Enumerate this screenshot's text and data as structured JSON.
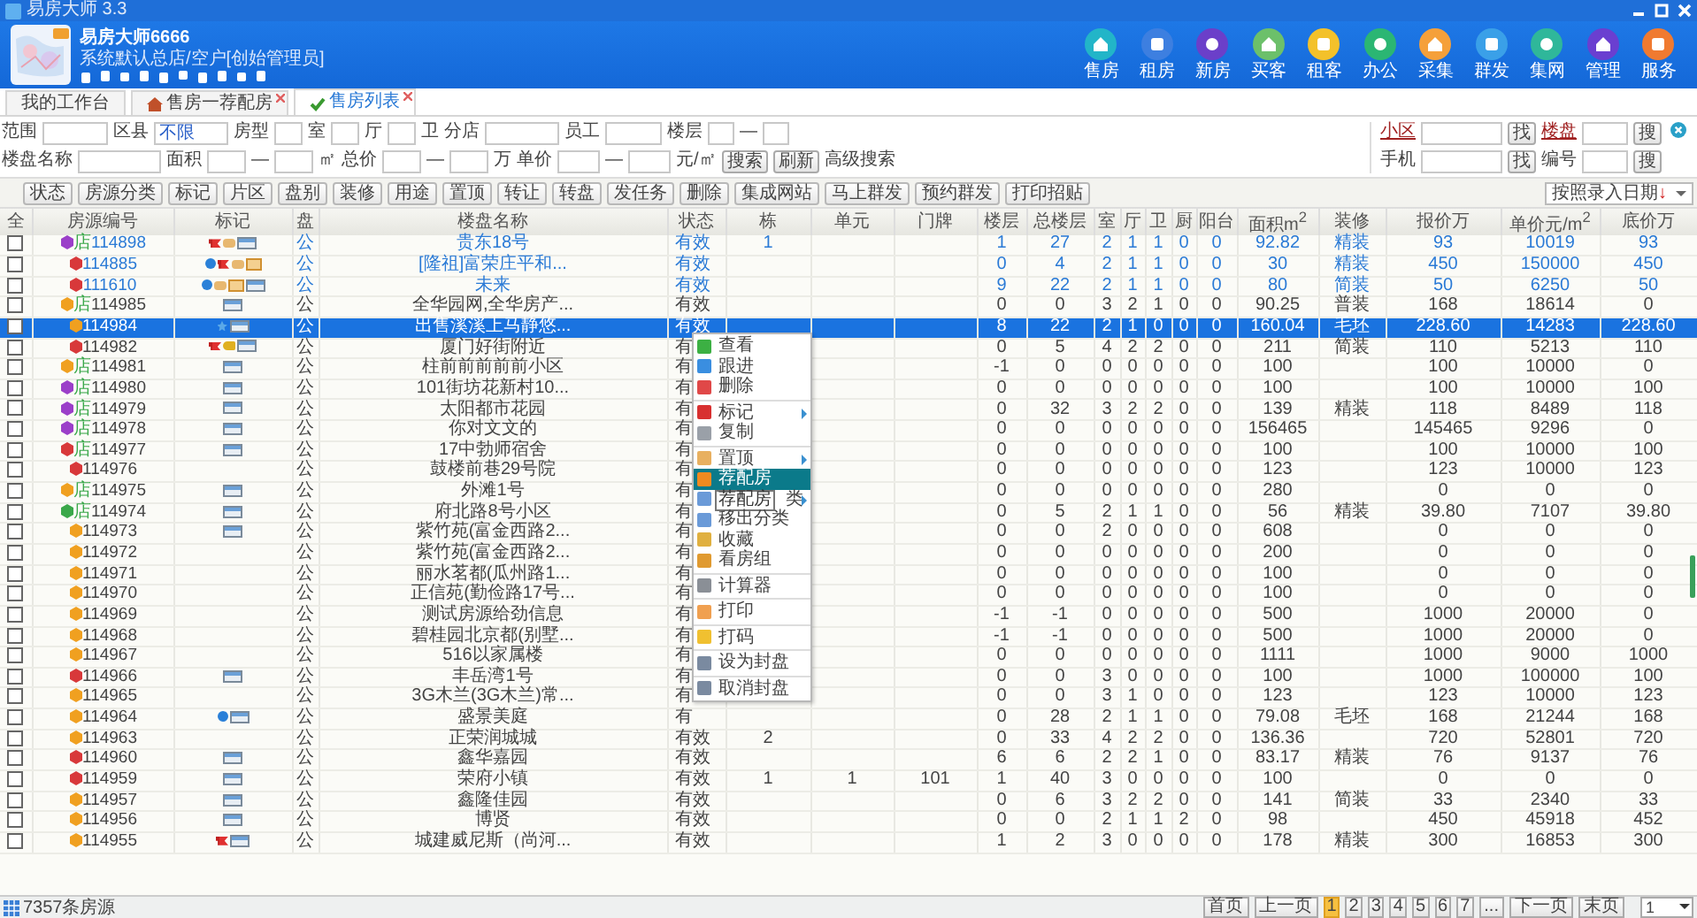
{
  "window": {
    "title": "易房大师 3.3"
  },
  "user": {
    "name": "易房大师6666",
    "role": "系统默认总店/空户[创始管理员]"
  },
  "nav": [
    {
      "label": "售房",
      "color": "#22b5c8"
    },
    {
      "label": "租房",
      "color": "#3d7fe0"
    },
    {
      "label": "新房",
      "color": "#6b3fc9"
    },
    {
      "label": "买客",
      "color": "#6cc06a"
    },
    {
      "label": "租客",
      "color": "#f3c12a"
    },
    {
      "label": "办公",
      "color": "#2bb673"
    },
    {
      "label": "采集",
      "color": "#f5a03a"
    },
    {
      "label": "群发",
      "color": "#3aa0e8"
    },
    {
      "label": "集网",
      "color": "#2fb79a"
    },
    {
      "label": "管理",
      "color": "#6a3fd0"
    },
    {
      "label": "服务",
      "color": "#f07a30"
    }
  ],
  "tabs": [
    {
      "label": "我的工作台",
      "selected": false,
      "closable": false
    },
    {
      "label": "售房一荐配房",
      "selected": false,
      "closable": true
    },
    {
      "label": "售房列表",
      "selected": true,
      "closable": true
    }
  ],
  "filters": [
    [
      {
        "kind": "label",
        "text": "范围"
      },
      {
        "kind": "input"
      },
      {
        "kind": "label",
        "text": "区县"
      },
      {
        "kind": "input",
        "value": "不限"
      },
      {
        "kind": "label",
        "text": "房型"
      },
      {
        "kind": "input"
      },
      {
        "kind": "label",
        "text": "室"
      },
      {
        "kind": "input"
      },
      {
        "kind": "label",
        "text": "厅"
      },
      {
        "kind": "input"
      },
      {
        "kind": "label",
        "text": "卫"
      },
      {
        "kind": "label",
        "text": "分店"
      },
      {
        "kind": "input"
      },
      {
        "kind": "label",
        "text": "员工"
      },
      {
        "kind": "input"
      },
      {
        "kind": "label",
        "text": "楼层"
      },
      {
        "kind": "input"
      },
      {
        "kind": "label",
        "text": "—"
      },
      {
        "kind": "input"
      }
    ],
    [
      {
        "kind": "label",
        "text": "楼盘名称"
      },
      {
        "kind": "input"
      },
      {
        "kind": "label",
        "text": "面积"
      },
      {
        "kind": "input"
      },
      {
        "kind": "label",
        "text": "—"
      },
      {
        "kind": "input"
      },
      {
        "kind": "label",
        "text": "㎡"
      },
      {
        "kind": "label",
        "text": "总价"
      },
      {
        "kind": "input"
      },
      {
        "kind": "label",
        "text": "—"
      },
      {
        "kind": "input"
      },
      {
        "kind": "label",
        "text": "万"
      },
      {
        "kind": "label",
        "text": "单价"
      },
      {
        "kind": "input"
      },
      {
        "kind": "label",
        "text": "—"
      },
      {
        "kind": "input"
      },
      {
        "kind": "label",
        "text": "元/㎡"
      },
      {
        "kind": "button",
        "text": "搜索"
      },
      {
        "kind": "button",
        "text": "刷新"
      },
      {
        "kind": "label",
        "text": "高级搜索"
      }
    ]
  ],
  "quick_search": [
    [
      {
        "kind": "link",
        "text": "小区"
      },
      {
        "kind": "input"
      },
      {
        "kind": "button",
        "text": "找"
      },
      {
        "kind": "link",
        "text": "楼盘"
      },
      {
        "kind": "input"
      },
      {
        "kind": "button",
        "text": "搜"
      }
    ],
    [
      {
        "kind": "label",
        "text": "手机"
      },
      {
        "kind": "input"
      },
      {
        "kind": "button",
        "text": "找"
      },
      {
        "kind": "label",
        "text": "编号"
      },
      {
        "kind": "input"
      },
      {
        "kind": "button",
        "text": "搜"
      }
    ]
  ],
  "toolbar": [
    "状态",
    "房源分类",
    "标记",
    "片区",
    "盘别",
    "装修",
    "用途",
    "置顶",
    "转让",
    "转盘",
    "发任务",
    "删除",
    "集成网站",
    "马上群发",
    "预约群发",
    "打印招贴"
  ],
  "sort": {
    "label": "按照录入日期",
    "arrow": "↓"
  },
  "table": {
    "columns": [
      "全",
      "房源编号",
      "标记",
      "盘",
      "楼盘名称",
      "状态",
      "栋",
      "单元",
      "门牌",
      "楼层",
      "总楼层",
      "室",
      "厅",
      "卫",
      "厨",
      "阳台",
      "面积m$^{2}$",
      "装修",
      "报价万",
      "单价元/m$^{2}$",
      "底价万"
    ],
    "rows": [
      {
        "checked": false,
        "selected": false,
        "highlight": true,
        "color": "#9b3fc9",
        "tag": "店",
        "id": "114898",
        "marks": [
          {
            "kind": "flag"
          },
          {
            "kind": "thumb"
          },
          {
            "kind": "card"
          }
        ],
        "pan": "公",
        "name": "贵东18号",
        "status": "有效",
        "building": "1",
        "floor": "1",
        "floors": "27",
        "rooms": "2",
        "halls": "1",
        "baths": "1",
        "kitchens": "0",
        "balconies": "0",
        "area": "92.82",
        "decoration": "精装",
        "price": "93",
        "unit_price": "10019",
        "base_price": "93"
      },
      {
        "checked": false,
        "selected": false,
        "highlight": true,
        "color": "#d8383a",
        "id": "114885",
        "marks": [
          {
            "kind": "paw"
          },
          {
            "kind": "flag"
          },
          {
            "kind": "thumb"
          },
          {
            "kind": "note"
          }
        ],
        "pan": "公",
        "name": "[隆祖]富荣庄平和...",
        "status": "有效",
        "floor": "0",
        "floors": "4",
        "rooms": "2",
        "halls": "1",
        "baths": "1",
        "kitchens": "0",
        "balconies": "0",
        "area": "30",
        "decoration": "精装",
        "price": "450",
        "unit_price": "150000",
        "base_price": "450"
      },
      {
        "checked": false,
        "selected": false,
        "highlight": true,
        "color": "#d8383a",
        "id": "111610",
        "marks": [
          {
            "kind": "paw"
          },
          {
            "kind": "thumb"
          },
          {
            "kind": "note"
          },
          {
            "kind": "card"
          }
        ],
        "pan": "公",
        "name": "未来",
        "status": "有效",
        "floor": "9",
        "floors": "22",
        "rooms": "2",
        "halls": "1",
        "baths": "1",
        "kitchens": "0",
        "balconies": "0",
        "area": "80",
        "decoration": "简装",
        "price": "50",
        "unit_price": "6250",
        "base_price": "50"
      },
      {
        "checked": false,
        "selected": false,
        "highlight": false,
        "color": "#f0a020",
        "tag": "店",
        "id": "114985",
        "marks": [
          {
            "kind": "card"
          }
        ],
        "pan": "公",
        "name": "全华园网,全华房产...",
        "status": "有效",
        "floor": "0",
        "floors": "0",
        "rooms": "3",
        "halls": "2",
        "baths": "1",
        "kitchens": "0",
        "balconies": "0",
        "area": "90.25",
        "decoration": "普装",
        "price": "168",
        "unit_price": "18614",
        "base_price": "0"
      },
      {
        "checked": false,
        "selected": true,
        "highlight": false,
        "color": "#f0a020",
        "id": "114984",
        "marks": [
          {
            "kind": "star"
          },
          {
            "kind": "card"
          }
        ],
        "pan": "公",
        "name": "出售溪溪上马静悠...",
        "status": "有效",
        "floor": "8",
        "floors": "22",
        "rooms": "2",
        "halls": "1",
        "baths": "0",
        "kitchens": "0",
        "balconies": "0",
        "area": "160.04",
        "decoration": "毛坯",
        "price": "228.60",
        "unit_price": "14283",
        "base_price": "228.60"
      },
      {
        "checked": false,
        "selected": false,
        "highlight": false,
        "color": "#d8383a",
        "id": "114982",
        "marks": [
          {
            "kind": "flag"
          },
          {
            "kind": "key"
          },
          {
            "kind": "card"
          }
        ],
        "pan": "公",
        "name": "厦门好街附近",
        "status": "有",
        "floor": "0",
        "floors": "5",
        "rooms": "4",
        "halls": "2",
        "baths": "2",
        "kitchens": "0",
        "balconies": "0",
        "area": "211",
        "decoration": "简装",
        "price": "110",
        "unit_price": "5213",
        "base_price": "110"
      },
      {
        "checked": false,
        "selected": false,
        "highlight": false,
        "color": "#f0a020",
        "tag": "店",
        "id": "114981",
        "marks": [
          {
            "kind": "card"
          }
        ],
        "pan": "公",
        "name": "柱前前前前前小区",
        "status": "有",
        "floor": "-1",
        "floors": "0",
        "rooms": "0",
        "halls": "0",
        "baths": "0",
        "kitchens": "0",
        "balconies": "0",
        "area": "100",
        "price": "100",
        "unit_price": "10000",
        "base_price": "0"
      },
      {
        "checked": false,
        "selected": false,
        "highlight": false,
        "color": "#9b3fc9",
        "tag": "店",
        "id": "114980",
        "marks": [
          {
            "kind": "card"
          }
        ],
        "pan": "公",
        "name": "101街坊花新村10...",
        "status": "有",
        "floor": "0",
        "floors": "0",
        "rooms": "0",
        "halls": "0",
        "baths": "0",
        "kitchens": "0",
        "balconies": "0",
        "area": "100",
        "price": "100",
        "unit_price": "10000",
        "base_price": "100"
      },
      {
        "checked": false,
        "selected": false,
        "highlight": false,
        "color": "#9b3fc9",
        "tag": "店",
        "id": "114979",
        "marks": [
          {
            "kind": "card"
          }
        ],
        "pan": "公",
        "name": "太阳都市花园",
        "status": "有",
        "floor": "0",
        "floors": "32",
        "rooms": "3",
        "halls": "2",
        "baths": "2",
        "kitchens": "0",
        "balconies": "0",
        "area": "139",
        "decoration": "精装",
        "price": "118",
        "unit_price": "8489",
        "base_price": "118"
      },
      {
        "checked": false,
        "selected": false,
        "highlight": false,
        "color": "#9b3fc9",
        "tag": "店",
        "id": "114978",
        "marks": [
          {
            "kind": "card"
          }
        ],
        "pan": "公",
        "name": "你对文文的",
        "status": "有",
        "floor": "0",
        "floors": "0",
        "rooms": "0",
        "halls": "0",
        "baths": "0",
        "kitchens": "0",
        "balconies": "0",
        "area": "156465",
        "price": "145465",
        "unit_price": "9296",
        "base_price": "0"
      },
      {
        "checked": false,
        "selected": false,
        "highlight": false,
        "color": "#d8383a",
        "tag": "店",
        "id": "114977",
        "marks": [
          {
            "kind": "card"
          }
        ],
        "pan": "公",
        "name": "17中勃师宿舍",
        "status": "有",
        "floor": "0",
        "floors": "0",
        "rooms": "0",
        "halls": "0",
        "baths": "0",
        "kitchens": "0",
        "balconies": "0",
        "area": "100",
        "price": "100",
        "unit_price": "10000",
        "base_price": "100"
      },
      {
        "checked": false,
        "selected": false,
        "highlight": false,
        "color": "#d8383a",
        "id": "114976",
        "pan": "公",
        "name": "鼓楼前巷29号院",
        "status": "有",
        "floor": "0",
        "floors": "0",
        "rooms": "0",
        "halls": "0",
        "baths": "0",
        "kitchens": "0",
        "balconies": "0",
        "area": "123",
        "price": "123",
        "unit_price": "10000",
        "base_price": "123"
      },
      {
        "checked": false,
        "selected": false,
        "highlight": false,
        "color": "#f0a020",
        "tag": "店",
        "id": "114975",
        "marks": [
          {
            "kind": "card"
          }
        ],
        "pan": "公",
        "name": "外滩1号",
        "status": "有",
        "floor": "0",
        "floors": "0",
        "rooms": "0",
        "halls": "0",
        "baths": "0",
        "kitchens": "0",
        "balconies": "0",
        "area": "280",
        "price": "0",
        "unit_price": "0",
        "base_price": "0"
      },
      {
        "checked": false,
        "selected": false,
        "highlight": false,
        "color": "#3aa84a",
        "tag": "店",
        "id": "114974",
        "marks": [
          {
            "kind": "card"
          }
        ],
        "pan": "公",
        "name": "府北路8号小区",
        "status": "有",
        "floor": "0",
        "floors": "5",
        "rooms": "2",
        "halls": "1",
        "baths": "1",
        "kitchens": "0",
        "balconies": "0",
        "area": "56",
        "decoration": "精装",
        "price": "39.80",
        "unit_price": "7107",
        "base_price": "39.80"
      },
      {
        "checked": false,
        "selected": false,
        "highlight": false,
        "color": "#f0a020",
        "id": "114973",
        "marks": [
          {
            "kind": "card"
          }
        ],
        "pan": "公",
        "name": "紫竹苑(富金西路2...",
        "status": "有",
        "floor": "0",
        "floors": "0",
        "rooms": "2",
        "halls": "0",
        "baths": "0",
        "kitchens": "0",
        "balconies": "0",
        "area": "608",
        "price": "0",
        "unit_price": "0",
        "base_price": "0"
      },
      {
        "checked": false,
        "selected": false,
        "highlight": false,
        "color": "#f0a020",
        "id": "114972",
        "pan": "公",
        "name": "紫竹苑(富金西路2...",
        "status": "有",
        "floor": "0",
        "floors": "0",
        "rooms": "0",
        "halls": "0",
        "baths": "0",
        "kitchens": "0",
        "balconies": "0",
        "area": "200",
        "price": "0",
        "unit_price": "0",
        "base_price": "0"
      },
      {
        "checked": false,
        "selected": false,
        "highlight": false,
        "color": "#f0a020",
        "id": "114971",
        "pan": "公",
        "name": "丽水茗都(瓜州路1...",
        "status": "有",
        "floor": "0",
        "floors": "0",
        "rooms": "0",
        "halls": "0",
        "baths": "0",
        "kitchens": "0",
        "balconies": "0",
        "area": "100",
        "price": "0",
        "unit_price": "0",
        "base_price": "0"
      },
      {
        "checked": false,
        "selected": false,
        "highlight": false,
        "color": "#f0a020",
        "id": "114970",
        "pan": "公",
        "name": "正信苑(勤俭路17号...",
        "status": "有",
        "floor": "0",
        "floors": "0",
        "rooms": "0",
        "halls": "0",
        "baths": "0",
        "kitchens": "0",
        "balconies": "0",
        "area": "100",
        "price": "0",
        "unit_price": "0",
        "base_price": "0"
      },
      {
        "checked": false,
        "selected": false,
        "highlight": false,
        "color": "#f0a020",
        "id": "114969",
        "pan": "公",
        "name": "测试房源给劲信息",
        "status": "有",
        "floor": "-1",
        "floors": "-1",
        "rooms": "0",
        "halls": "0",
        "baths": "0",
        "kitchens": "0",
        "balconies": "0",
        "area": "500",
        "price": "1000",
        "unit_price": "20000",
        "base_price": "0"
      },
      {
        "checked": false,
        "selected": false,
        "highlight": false,
        "color": "#f0a020",
        "id": "114968",
        "pan": "公",
        "name": "碧桂园北京都(别墅...",
        "status": "有",
        "floor": "-1",
        "floors": "-1",
        "rooms": "0",
        "halls": "0",
        "baths": "0",
        "kitchens": "0",
        "balconies": "0",
        "area": "500",
        "price": "1000",
        "unit_price": "20000",
        "base_price": "0"
      },
      {
        "checked": false,
        "selected": false,
        "highlight": false,
        "color": "#f0a020",
        "id": "114967",
        "pan": "公",
        "name": "516以家属楼",
        "status": "有",
        "floor": "0",
        "floors": "0",
        "rooms": "0",
        "halls": "0",
        "baths": "0",
        "kitchens": "0",
        "balconies": "0",
        "area": "1111",
        "price": "1000",
        "unit_price": "9000",
        "base_price": "1000"
      },
      {
        "checked": false,
        "selected": false,
        "highlight": false,
        "color": "#d8383a",
        "id": "114966",
        "marks": [
          {
            "kind": "card"
          }
        ],
        "pan": "公",
        "name": "丰岳湾1号",
        "status": "有",
        "floor": "0",
        "floors": "0",
        "rooms": "3",
        "halls": "0",
        "baths": "0",
        "kitchens": "0",
        "balconies": "0",
        "area": "100",
        "price": "1000",
        "unit_price": "100000",
        "base_price": "100"
      },
      {
        "checked": false,
        "selected": false,
        "highlight": false,
        "color": "#f0a020",
        "id": "114965",
        "pan": "公",
        "name": "3G木兰(3G木兰)常...",
        "status": "有",
        "floor": "0",
        "floors": "0",
        "rooms": "3",
        "halls": "1",
        "baths": "0",
        "kitchens": "0",
        "balconies": "0",
        "area": "123",
        "price": "123",
        "unit_price": "10000",
        "base_price": "123"
      },
      {
        "checked": false,
        "selected": false,
        "highlight": false,
        "color": "#f0a020",
        "id": "114964",
        "marks": [
          {
            "kind": "paw"
          },
          {
            "kind": "card"
          }
        ],
        "pan": "公",
        "name": "盛景美庭",
        "status": "有",
        "floor": "0",
        "floors": "28",
        "rooms": "2",
        "halls": "1",
        "baths": "1",
        "kitchens": "0",
        "balconies": "0",
        "area": "79.08",
        "decoration": "毛坯",
        "price": "168",
        "unit_price": "21244",
        "base_price": "168"
      },
      {
        "checked": false,
        "selected": false,
        "highlight": false,
        "color": "#f0a020",
        "id": "114963",
        "pan": "公",
        "name": "正荣润城城",
        "status": "有效",
        "building": "2",
        "floor": "0",
        "floors": "33",
        "rooms": "4",
        "halls": "2",
        "baths": "2",
        "kitchens": "0",
        "balconies": "0",
        "area": "136.36",
        "price": "720",
        "unit_price": "52801",
        "base_price": "720"
      },
      {
        "checked": false,
        "selected": false,
        "highlight": false,
        "color": "#d8383a",
        "id": "114960",
        "marks": [
          {
            "kind": "card"
          }
        ],
        "pan": "公",
        "name": "鑫华嘉园",
        "status": "有效",
        "floor": "6",
        "floors": "6",
        "rooms": "2",
        "halls": "2",
        "baths": "1",
        "kitchens": "0",
        "balconies": "0",
        "area": "83.17",
        "decoration": "精装",
        "price": "76",
        "unit_price": "9137",
        "base_price": "76"
      },
      {
        "checked": false,
        "selected": false,
        "highlight": false,
        "color": "#d8383a",
        "id": "114959",
        "marks": [
          {
            "kind": "card"
          }
        ],
        "pan": "公",
        "name": "荣府小镇",
        "status": "有效",
        "building": "1",
        "unit": "1",
        "door": "101",
        "floor": "1",
        "floors": "40",
        "rooms": "3",
        "halls": "0",
        "baths": "0",
        "kitchens": "0",
        "balconies": "0",
        "area": "100",
        "price": "0",
        "unit_price": "0",
        "base_price": "0"
      },
      {
        "checked": false,
        "selected": false,
        "highlight": false,
        "color": "#f0a020",
        "id": "114957",
        "marks": [
          {
            "kind": "card"
          }
        ],
        "pan": "公",
        "name": "鑫隆佳园",
        "status": "有效",
        "floor": "0",
        "floors": "6",
        "rooms": "3",
        "halls": "2",
        "baths": "2",
        "kitchens": "0",
        "balconies": "0",
        "area": "141",
        "decoration": "简装",
        "price": "33",
        "unit_price": "2340",
        "base_price": "33"
      },
      {
        "checked": false,
        "selected": false,
        "highlight": false,
        "color": "#f0a020",
        "id": "114956",
        "marks": [
          {
            "kind": "card"
          }
        ],
        "pan": "公",
        "name": "博贤",
        "status": "有效",
        "floor": "0",
        "floors": "0",
        "rooms": "2",
        "halls": "1",
        "baths": "1",
        "kitchens": "2",
        "balconies": "0",
        "area": "98",
        "price": "450",
        "unit_price": "45918",
        "base_price": "452"
      },
      {
        "checked": false,
        "selected": false,
        "highlight": false,
        "color": "#f0a020",
        "id": "114955",
        "marks": [
          {
            "kind": "flag"
          },
          {
            "kind": "card"
          }
        ],
        "pan": "公",
        "name": "城建威尼斯（尚河...",
        "status": "有效",
        "floor": "1",
        "floors": "2",
        "rooms": "3",
        "halls": "0",
        "baths": "0",
        "kitchens": "0",
        "balconies": "0",
        "area": "178",
        "decoration": "精装",
        "price": "300",
        "unit_price": "16853",
        "base_price": "300"
      }
    ]
  },
  "context_menu": {
    "groups": [
      [
        {
          "label": "查看",
          "submenu": false,
          "highlighted": false
        },
        {
          "label": "跟进",
          "submenu": false,
          "highlighted": false
        },
        {
          "label": "删除",
          "submenu": false,
          "highlighted": false
        }
      ],
      [
        {
          "label": "标记",
          "submenu": true,
          "highlighted": false
        },
        {
          "label": "复制",
          "submenu": false,
          "highlighted": false
        }
      ],
      [
        {
          "label": "置顶",
          "submenu": true,
          "highlighted": false
        },
        {
          "label": "荐配房",
          "submenu": false,
          "highlighted": true
        },
        {
          "label": "类",
          "submenu": true,
          "highlighted": false,
          "tooltip": "荐配房"
        },
        {
          "label": "移出分类",
          "submenu": false,
          "highlighted": false
        },
        {
          "label": "收藏",
          "submenu": false,
          "highlighted": false
        },
        {
          "label": "看房组",
          "submenu": false,
          "highlighted": false
        }
      ],
      [
        {
          "label": "计算器",
          "submenu": false,
          "highlighted": false
        }
      ],
      [
        {
          "label": "打印",
          "submenu": false,
          "highlighted": false
        }
      ],
      [
        {
          "label": "打码",
          "submenu": false,
          "highlighted": false
        }
      ],
      [
        {
          "label": "设为封盘",
          "submenu": false,
          "highlighted": false
        }
      ],
      [
        {
          "label": "取消封盘",
          "submenu": false,
          "highlighted": false
        }
      ]
    ]
  },
  "status_bar": {
    "count": "7357条房源"
  },
  "pagination": {
    "first": "首页",
    "prev": "上一页",
    "pages": [
      {
        "label": "1",
        "selected": true
      },
      {
        "label": "2",
        "selected": false
      },
      {
        "label": "3",
        "selected": false
      },
      {
        "label": "4",
        "selected": false
      },
      {
        "label": "5",
        "selected": false
      },
      {
        "label": "6",
        "selected": false
      },
      {
        "label": "7",
        "selected": false
      }
    ],
    "ellipsis": "...",
    "next": "下一页",
    "last": "末页",
    "jump": "1"
  }
}
